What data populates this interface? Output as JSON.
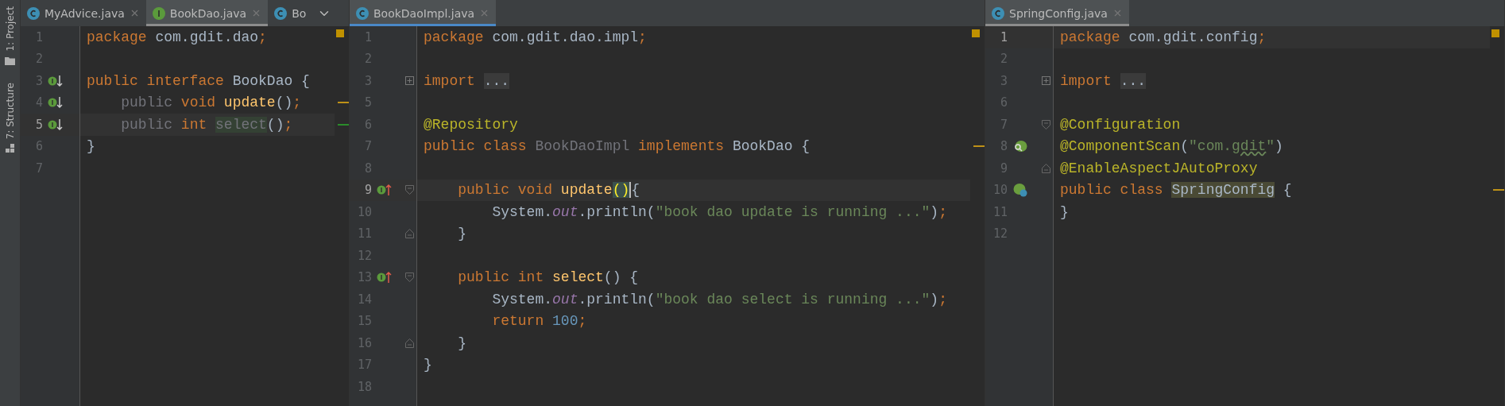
{
  "tool_strip": [
    {
      "label": "1: Project"
    },
    {
      "label": "7: Structure"
    }
  ],
  "panes": [
    {
      "active": false,
      "chevron": true,
      "tabs": [
        {
          "label": "MyAdvice.java",
          "kind": "class",
          "selected": false,
          "closable": true
        },
        {
          "label": "BookDao.java",
          "kind": "interface",
          "selected": true,
          "closable": true
        },
        {
          "label": "Bo",
          "kind": "class",
          "selected": false,
          "closable": false
        }
      ],
      "lines": [
        {
          "num": "1",
          "current": false,
          "tokens": [
            {
              "text": "package ",
              "kind": "kw"
            },
            {
              "text": "com.gdit.dao",
              "kind": "plain"
            },
            {
              "text": ";",
              "kind": "kw"
            }
          ]
        },
        {
          "num": "2",
          "current": false
        },
        {
          "num": "3",
          "current": false,
          "gutter": {
            "kind": "impl-down"
          },
          "tokens": [
            {
              "text": "public interface ",
              "kind": "kw"
            },
            {
              "text": "BookDao ",
              "kind": "plain"
            },
            {
              "text": "{",
              "kind": "plain"
            }
          ]
        },
        {
          "num": "4",
          "current": false,
          "gutter": {
            "kind": "impl-down"
          },
          "marker": {
            "kind": "warning"
          },
          "tokens": [
            {
              "text": "    public ",
              "kind": "muted"
            },
            {
              "text": "void ",
              "kind": "kw"
            },
            {
              "text": "update",
              "kind": "method"
            },
            {
              "text": "()",
              "kind": "plain"
            },
            {
              "text": ";",
              "kind": "kw"
            }
          ]
        },
        {
          "num": "5",
          "current": true,
          "gutter": {
            "kind": "impl-down"
          },
          "marker": {
            "kind": "ok"
          },
          "tokens": [
            {
              "text": "    public ",
              "kind": "muted"
            },
            {
              "text": "int ",
              "kind": "kw"
            },
            {
              "text": "select",
              "kind": "usage"
            },
            {
              "text": "()",
              "kind": "plain"
            },
            {
              "text": ";",
              "kind": "kw"
            }
          ]
        },
        {
          "num": "6",
          "current": false,
          "tokens": [
            {
              "text": "}",
              "kind": "plain"
            }
          ]
        },
        {
          "num": "7",
          "current": false
        }
      ]
    },
    {
      "active": true,
      "chevron": false,
      "tabs": [
        {
          "label": "BookDaoImpl.java",
          "kind": "class",
          "selected": true,
          "closable": true
        }
      ],
      "lines": [
        {
          "num": "1",
          "current": false,
          "tokens": [
            {
              "text": "package ",
              "kind": "kw"
            },
            {
              "text": "com.gdit.dao.impl",
              "kind": "plain"
            },
            {
              "text": ";",
              "kind": "kw"
            }
          ]
        },
        {
          "num": "2",
          "current": false
        },
        {
          "num": "3",
          "current": false,
          "fold": {
            "kind": "plus"
          },
          "tokens": [
            {
              "text": "import ",
              "kind": "kw"
            },
            {
              "text": "...",
              "kind": "folded"
            }
          ]
        },
        {
          "num": "5",
          "current": false
        },
        {
          "num": "6",
          "current": false,
          "tokens": [
            {
              "text": "@Repository",
              "kind": "annotation"
            }
          ]
        },
        {
          "num": "7",
          "current": false,
          "marker": {
            "kind": "warning"
          },
          "tokens": [
            {
              "text": "public class ",
              "kind": "kw"
            },
            {
              "text": "BookDaoImpl ",
              "kind": "muted"
            },
            {
              "text": "implements ",
              "kind": "kw"
            },
            {
              "text": "BookDao ",
              "kind": "plain"
            },
            {
              "text": "{",
              "kind": "plain"
            }
          ]
        },
        {
          "num": "8",
          "current": false
        },
        {
          "num": "9",
          "current": true,
          "gutter": {
            "kind": "impl-up"
          },
          "fold": {
            "kind": "open"
          },
          "tokens": [
            {
              "text": "    public void ",
              "kind": "kw"
            },
            {
              "text": "update",
              "kind": "method"
            },
            {
              "text": "()",
              "kind": "brace"
            },
            {
              "text": "{",
              "kind": "plain"
            }
          ]
        },
        {
          "num": "10",
          "current": false,
          "tokens": [
            {
              "text": "        System.",
              "kind": "plain"
            },
            {
              "text": "out",
              "kind": "field"
            },
            {
              "text": ".println(",
              "kind": "plain"
            },
            {
              "text": "\"book dao update is running ...\"",
              "kind": "string"
            },
            {
              "text": ")",
              "kind": "plain"
            },
            {
              "text": ";",
              "kind": "kw"
            }
          ]
        },
        {
          "num": "11",
          "current": false,
          "fold": {
            "kind": "close"
          },
          "tokens": [
            {
              "text": "    }",
              "kind": "plain"
            }
          ]
        },
        {
          "num": "12",
          "current": false
        },
        {
          "num": "13",
          "current": false,
          "gutter": {
            "kind": "impl-up"
          },
          "fold": {
            "kind": "open"
          },
          "tokens": [
            {
              "text": "    public int ",
              "kind": "kw"
            },
            {
              "text": "select",
              "kind": "method"
            },
            {
              "text": "() {",
              "kind": "plain"
            }
          ]
        },
        {
          "num": "14",
          "current": false,
          "tokens": [
            {
              "text": "        System.",
              "kind": "plain"
            },
            {
              "text": "out",
              "kind": "field"
            },
            {
              "text": ".println(",
              "kind": "plain"
            },
            {
              "text": "\"book dao select is running ...\"",
              "kind": "string"
            },
            {
              "text": ")",
              "kind": "plain"
            },
            {
              "text": ";",
              "kind": "kw"
            }
          ]
        },
        {
          "num": "15",
          "current": false,
          "tokens": [
            {
              "text": "        return ",
              "kind": "kw"
            },
            {
              "text": "100",
              "kind": "number"
            },
            {
              "text": ";",
              "kind": "kw"
            }
          ]
        },
        {
          "num": "16",
          "current": false,
          "fold": {
            "kind": "close"
          },
          "tokens": [
            {
              "text": "    }",
              "kind": "plain"
            }
          ]
        },
        {
          "num": "17",
          "current": false,
          "tokens": [
            {
              "text": "}",
              "kind": "plain"
            }
          ]
        },
        {
          "num": "18",
          "current": false
        }
      ]
    },
    {
      "active": false,
      "chevron": false,
      "tabs": [
        {
          "label": "SpringConfig.java",
          "kind": "class",
          "selected": true,
          "closable": true
        }
      ],
      "lines": [
        {
          "num": "1",
          "current": true,
          "tokens": [
            {
              "text": "package ",
              "kind": "kw"
            },
            {
              "text": "com.gdit.config",
              "kind": "plain"
            },
            {
              "text": ";",
              "kind": "kw"
            }
          ]
        },
        {
          "num": "2",
          "current": false
        },
        {
          "num": "3",
          "current": false,
          "fold": {
            "kind": "plus"
          },
          "tokens": [
            {
              "text": "import ",
              "kind": "kw"
            },
            {
              "text": "...",
              "kind": "folded"
            }
          ]
        },
        {
          "num": "6",
          "current": false
        },
        {
          "num": "7",
          "current": false,
          "fold": {
            "kind": "open"
          },
          "tokens": [
            {
              "text": "@Configuration",
              "kind": "annotation"
            }
          ]
        },
        {
          "num": "8",
          "current": false,
          "gutter": {
            "kind": "spring-scan"
          },
          "tokens": [
            {
              "text": "@ComponentScan",
              "kind": "annotation"
            },
            {
              "text": "(",
              "kind": "plain"
            },
            {
              "text": "\"com.",
              "kind": "string"
            },
            {
              "text": "gdit",
              "kind": "typo"
            },
            {
              "text": "\"",
              "kind": "string"
            },
            {
              "text": ")",
              "kind": "plain"
            }
          ]
        },
        {
          "num": "9",
          "current": false,
          "fold": {
            "kind": "close"
          },
          "tokens": [
            {
              "text": "@EnableAspectJAutoProxy",
              "kind": "annotation"
            }
          ]
        },
        {
          "num": "10",
          "current": false,
          "gutter": {
            "kind": "spring-bean"
          },
          "marker": {
            "kind": "warning"
          },
          "tokens": [
            {
              "text": "public class ",
              "kind": "kw"
            },
            {
              "text": "SpringConfig",
              "kind": "declared"
            },
            {
              "text": " {",
              "kind": "plain"
            }
          ]
        },
        {
          "num": "11",
          "current": false,
          "tokens": [
            {
              "text": "}",
              "kind": "plain"
            }
          ]
        },
        {
          "num": "12",
          "current": false
        }
      ]
    }
  ]
}
